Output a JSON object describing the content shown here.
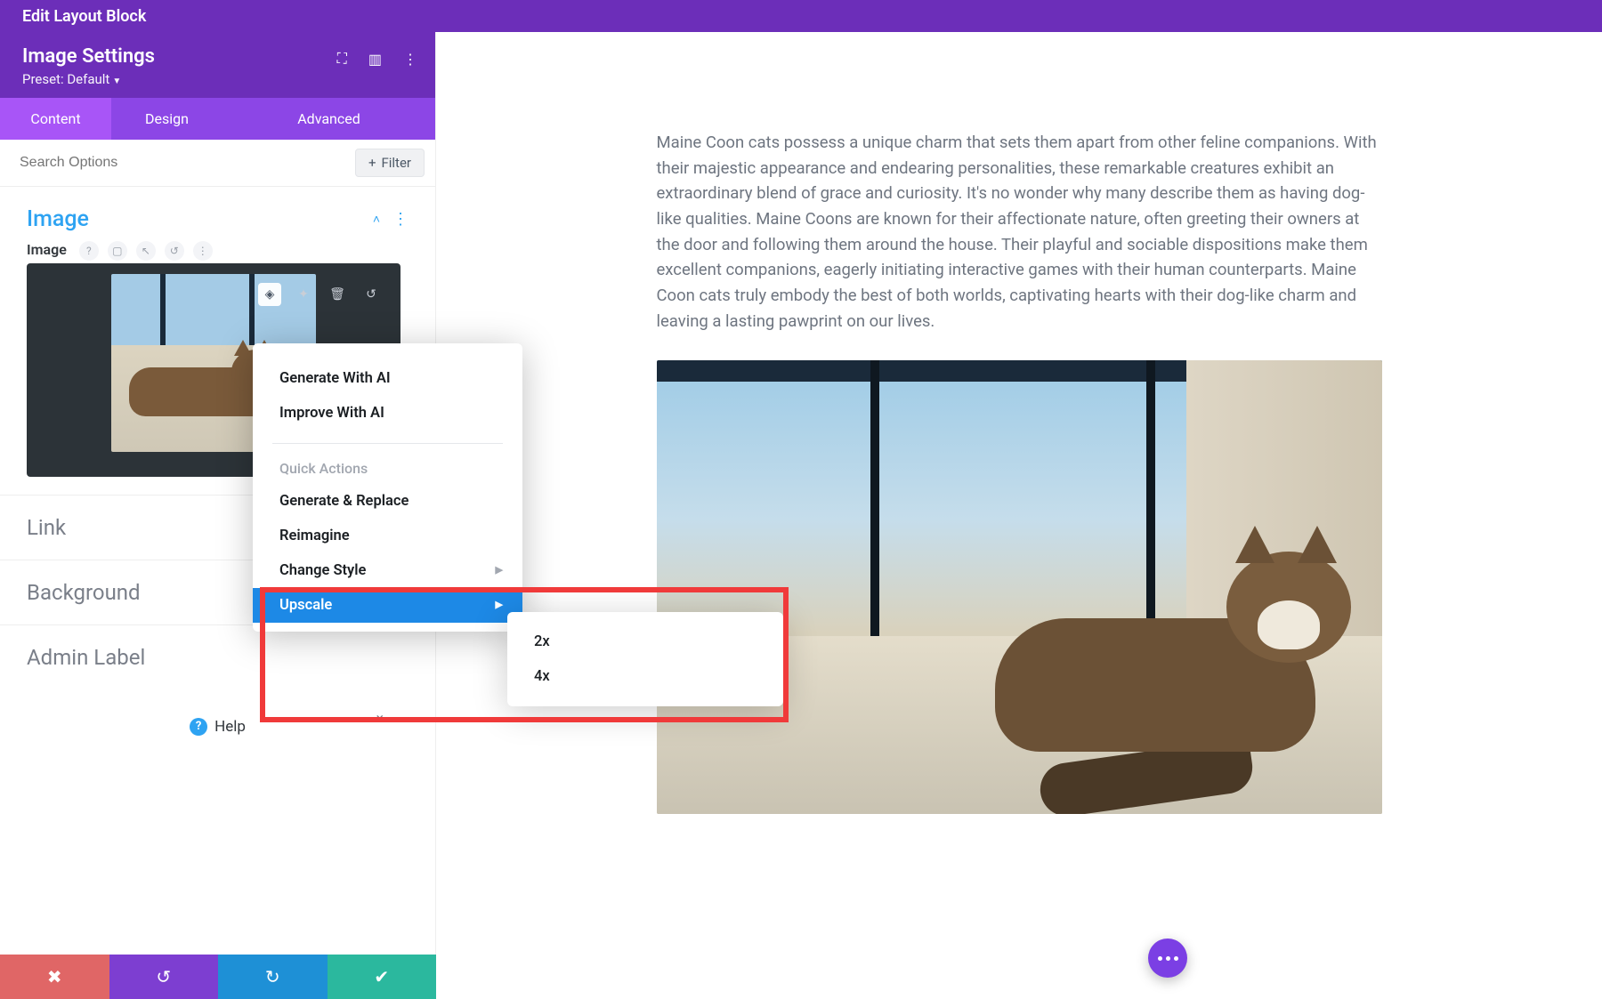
{
  "top": {
    "title": "Edit Layout Block"
  },
  "panel": {
    "title": "Image Settings",
    "preset": "Preset: Default"
  },
  "tabs": {
    "content": "Content",
    "design": "Design",
    "advanced": "Advanced"
  },
  "search": {
    "placeholder": "Search Options",
    "filter": "Filter"
  },
  "section": {
    "image_head": "Image",
    "image_field_label": "Image"
  },
  "accordion": {
    "link": "Link",
    "background": "Background",
    "admin_label": "Admin Label"
  },
  "help": {
    "label": "Help"
  },
  "ai_menu": {
    "generate": "Generate With AI",
    "improve": "Improve With AI",
    "quick": "Quick Actions",
    "gen_replace": "Generate & Replace",
    "reimagine": "Reimagine",
    "change_style": "Change Style",
    "upscale": "Upscale"
  },
  "upscale_sub": {
    "x2": "2x",
    "x4": "4x"
  },
  "article": {
    "paragraph": "Maine Coon cats possess a unique charm that sets them apart from other feline companions. With their majestic appearance and endearing personalities, these remarkable creatures exhibit an extraordinary blend of grace and curiosity. It's no wonder why many describe them as having dog-like qualities. Maine Coons are known for their affectionate nature, often greeting their owners at the door and following them around the house. Their playful and sociable dispositions make them excellent companions, eagerly initiating interactive games with their human counterparts. Maine Coon cats truly embody the best of both worlds, captivating hearts with their dog-like charm and leaving a lasting pawprint on our lives."
  }
}
